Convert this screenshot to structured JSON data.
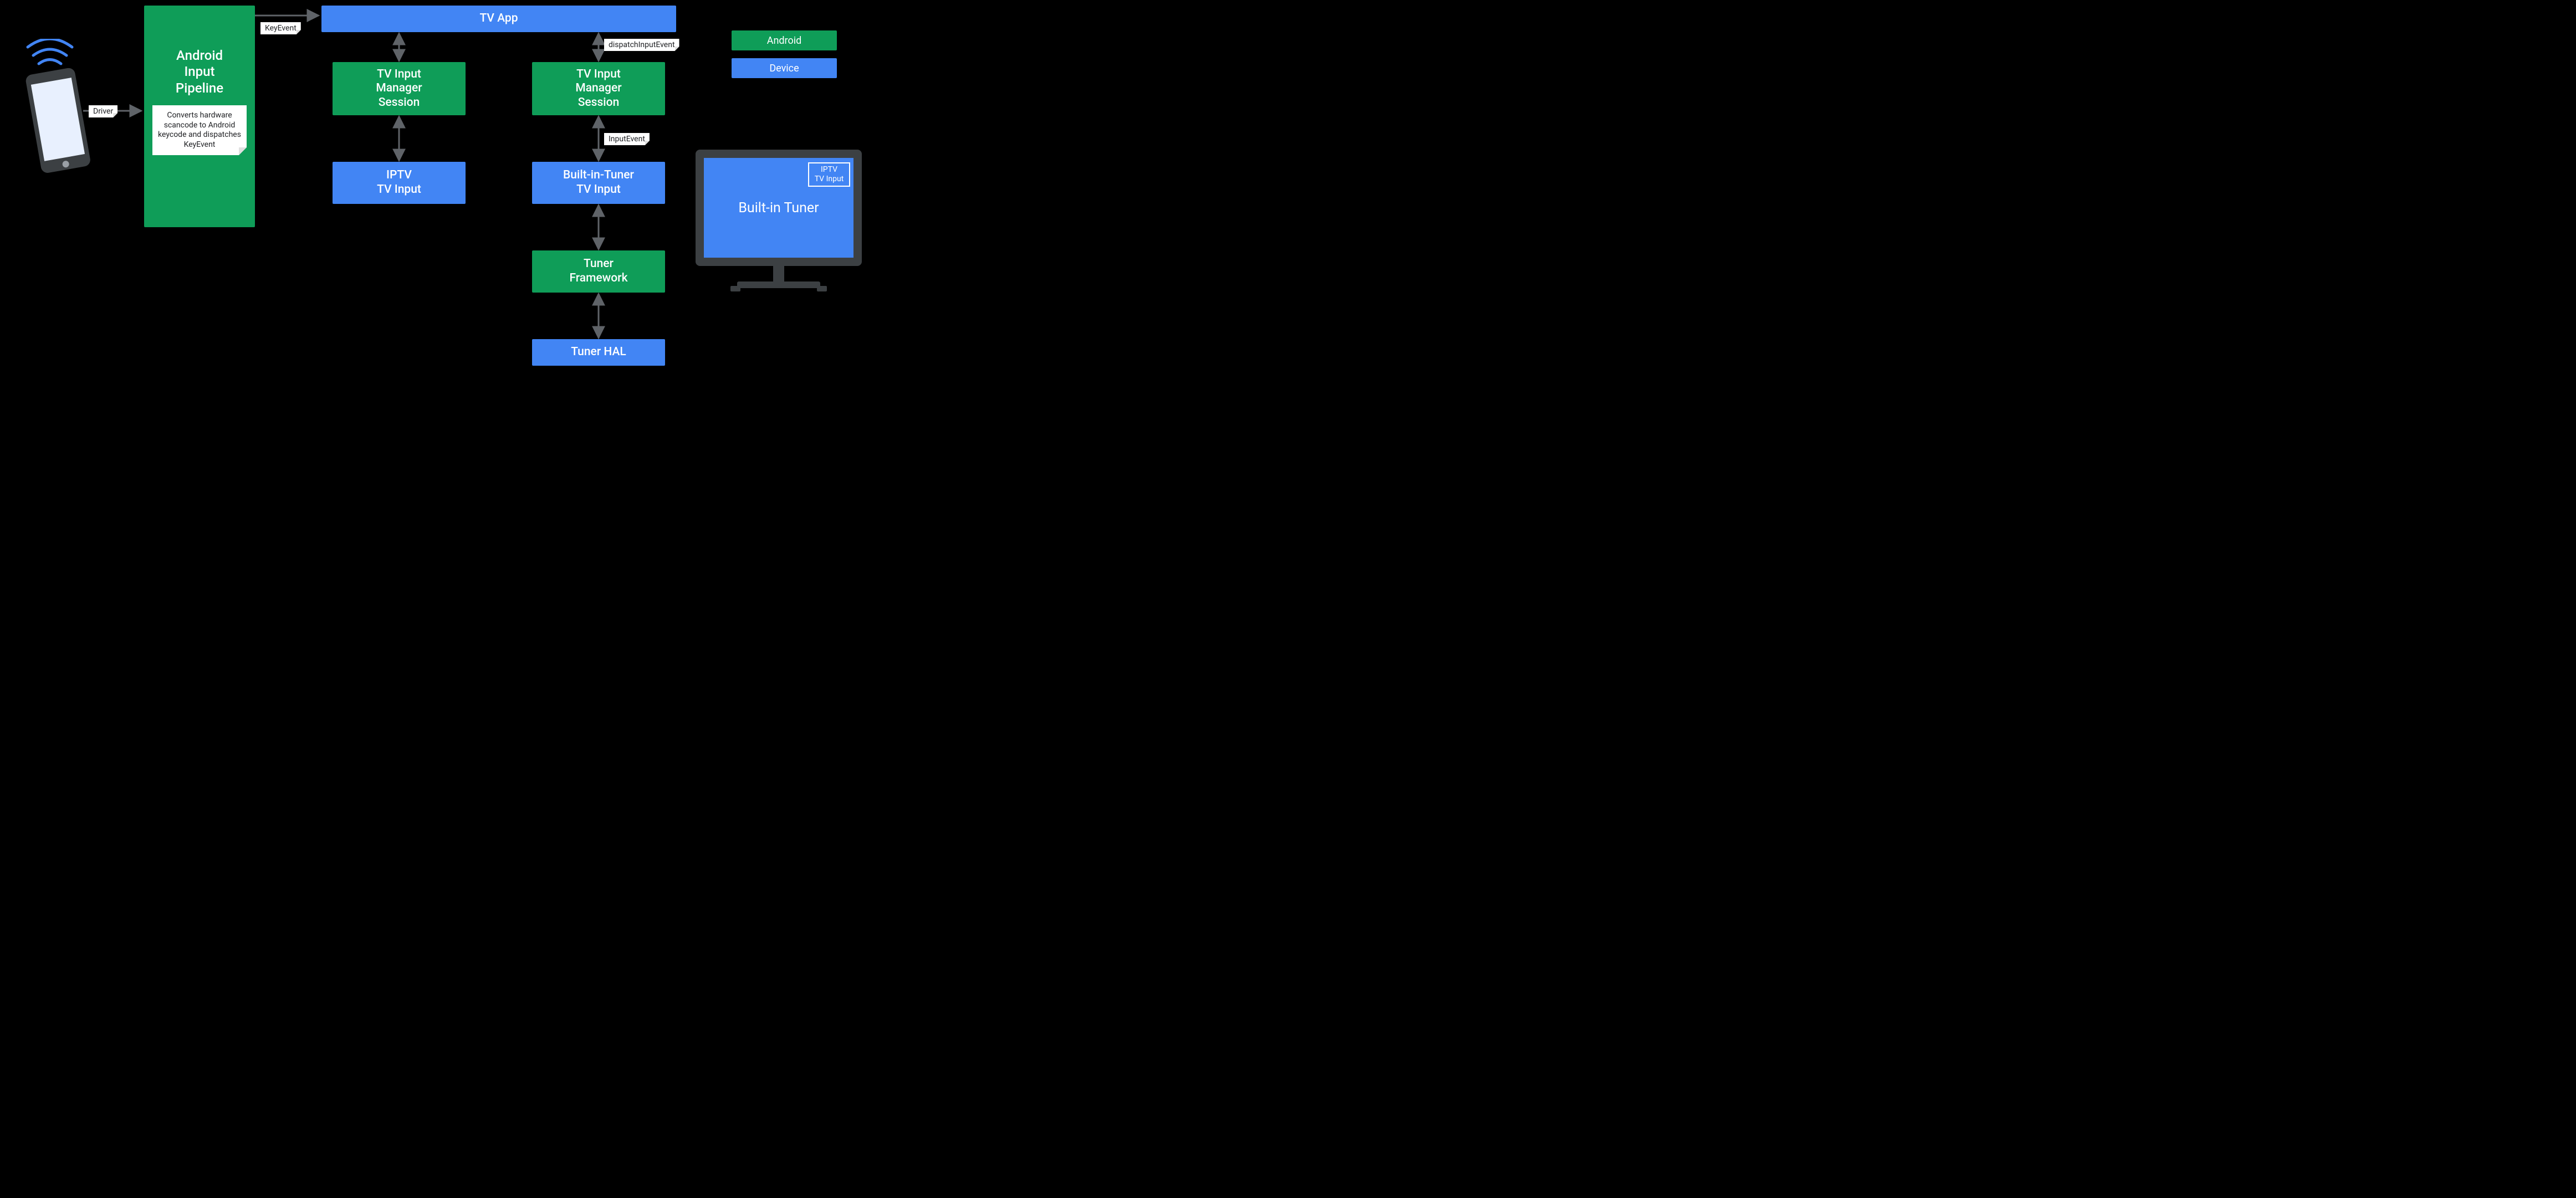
{
  "legend": {
    "android": "Android",
    "device": "Device"
  },
  "pipeline": {
    "title": "Android\nInput\nPipeline",
    "note": "Converts hardware scancode to Android keycode and dispatches KeyEvent"
  },
  "labels": {
    "driver": "Driver",
    "keyEvent": "KeyEvent",
    "dispatchInputEvent": "dispatchInputEvent",
    "inputEvent": "InputEvent"
  },
  "boxes": {
    "tvApp": "TV App",
    "tims1": "TV Input\nManager\nSession",
    "tims2": "TV Input\nManager\nSession",
    "iptv": "IPTV\nTV Input",
    "builtInTunerInput": "Built-in-Tuner\nTV Input",
    "tunerFw": "Tuner\nFramework",
    "tunerHal": "Tuner HAL"
  },
  "monitor": {
    "title": "Built-in Tuner",
    "inset": "IPTV\nTV Input"
  },
  "colors": {
    "android": "#0f9d58",
    "device": "#4285f4"
  }
}
